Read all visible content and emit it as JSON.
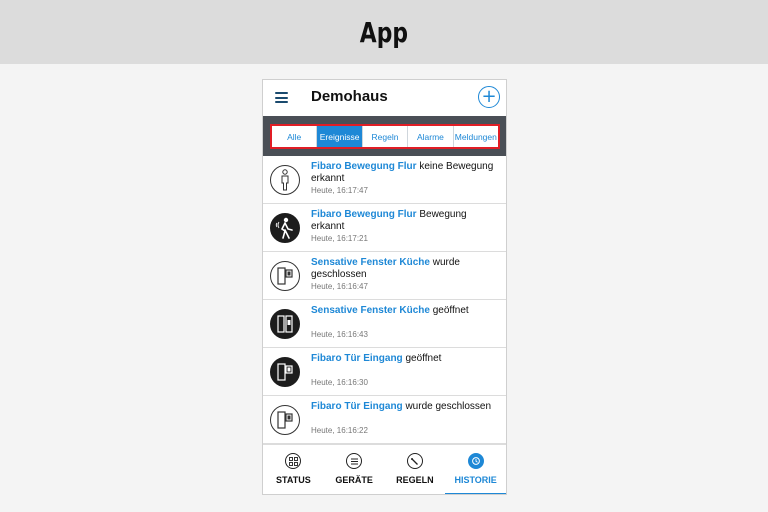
{
  "banner": {
    "title": "App"
  },
  "header": {
    "title": "Demohaus",
    "add_symbol": "+"
  },
  "tabs": [
    {
      "label": "Alle",
      "active": false
    },
    {
      "label": "Ereignisse",
      "active": true
    },
    {
      "label": "Regeln",
      "active": false
    },
    {
      "label": "Alarme",
      "active": false
    },
    {
      "label": "Meldungen",
      "active": false
    }
  ],
  "events": [
    {
      "device": "Fibaro Bewegung Flur",
      "action": "keine Bewegung erkannt",
      "time": "Heute, 16:17:47",
      "icon": "person-standing-icon",
      "style": "light"
    },
    {
      "device": "Fibaro Bewegung Flur",
      "action": "Bewegung erkannt",
      "time": "Heute, 16:17:21",
      "icon": "person-walking-icon",
      "style": "dark"
    },
    {
      "device": "Sensative Fenster Küche",
      "action": "wurde geschlossen",
      "time": "Heute, 16:16:47",
      "icon": "window-closed-icon",
      "style": "light"
    },
    {
      "device": "Sensative Fenster Küche",
      "action": "geöffnet",
      "time": "Heute, 16:16:43",
      "icon": "window-open-icon",
      "style": "dark"
    },
    {
      "device": "Fibaro Tür Eingang",
      "action": "geöffnet",
      "time": "Heute, 16:16:30",
      "icon": "door-open-icon",
      "style": "dark"
    },
    {
      "device": "Fibaro Tür Eingang",
      "action": "wurde geschlossen",
      "time": "Heute, 16:16:22",
      "icon": "door-closed-icon",
      "style": "light"
    }
  ],
  "bottom_nav": [
    {
      "label": "STATUS",
      "icon": "status-grid-icon",
      "active": false
    },
    {
      "label": "GERÄTE",
      "icon": "devices-list-icon",
      "active": false
    },
    {
      "label": "REGELN",
      "icon": "rules-wand-icon",
      "active": false
    },
    {
      "label": "HISTORIE",
      "icon": "history-clock-icon",
      "active": true
    }
  ],
  "colors": {
    "accent": "#1e88d6",
    "highlight_border": "#e11d25",
    "tabbar_bg": "#4a4f56"
  }
}
